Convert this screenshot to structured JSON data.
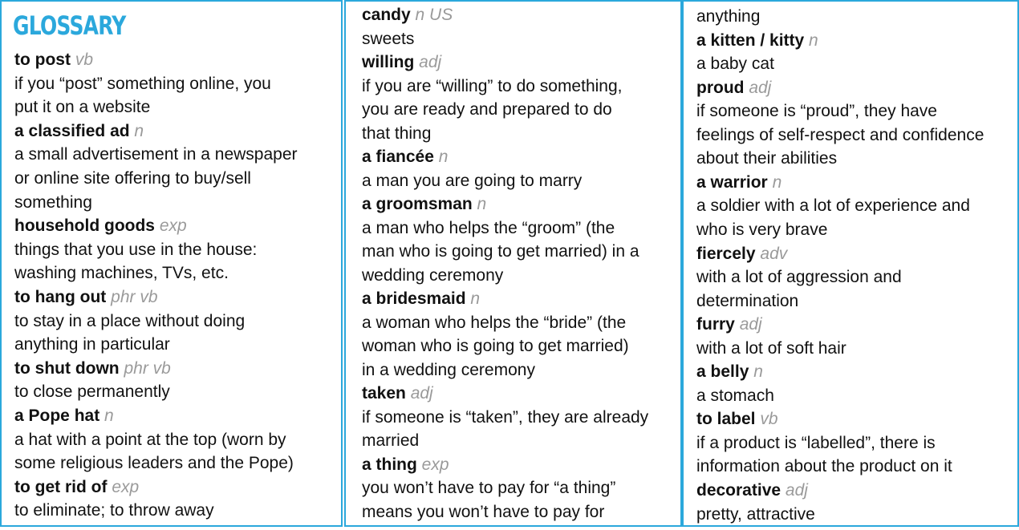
{
  "heading": "GLOSSARY",
  "columns": [
    {
      "lines": [
        {
          "type": "term",
          "term": "to post",
          "pos": "vb"
        },
        {
          "type": "text",
          "text": "if you “post” something online, you"
        },
        {
          "type": "text",
          "text": "put it on a website"
        },
        {
          "type": "term",
          "term": "a classified ad",
          "pos": "n"
        },
        {
          "type": "text",
          "text": "a small advertisement in a newspaper"
        },
        {
          "type": "text",
          "text": "or online site offering to buy/sell"
        },
        {
          "type": "text",
          "text": "something"
        },
        {
          "type": "term",
          "term": "household goods",
          "pos": "exp"
        },
        {
          "type": "text",
          "text": "things that you use in the house:"
        },
        {
          "type": "text",
          "text": "washing machines, TVs, etc."
        },
        {
          "type": "term",
          "term": "to hang out",
          "pos": "phr vb"
        },
        {
          "type": "text",
          "text": "to stay in a place without doing"
        },
        {
          "type": "text",
          "text": "anything in particular"
        },
        {
          "type": "term",
          "term": "to shut down",
          "pos": "phr vb"
        },
        {
          "type": "text",
          "text": "to close permanently"
        },
        {
          "type": "term",
          "term": "a Pope hat",
          "pos": "n"
        },
        {
          "type": "text",
          "text": "a hat with a point at the top (worn by"
        },
        {
          "type": "text",
          "text": "some religious leaders and the Pope)"
        },
        {
          "type": "term",
          "term": "to get rid of",
          "pos": "exp"
        },
        {
          "type": "text",
          "text": "to eliminate; to throw away"
        }
      ]
    },
    {
      "lines": [
        {
          "type": "term",
          "term": "candy",
          "pos": "n US"
        },
        {
          "type": "text",
          "text": "sweets"
        },
        {
          "type": "term",
          "term": "willing",
          "pos": "adj"
        },
        {
          "type": "text",
          "text": "if you are “willing” to do something,"
        },
        {
          "type": "text",
          "text": "you are ready and prepared to do"
        },
        {
          "type": "text",
          "text": "that thing"
        },
        {
          "type": "term",
          "term": "a fiancée",
          "pos": "n"
        },
        {
          "type": "text",
          "text": "a man you are going to marry"
        },
        {
          "type": "term",
          "term": "a groomsman",
          "pos": "n"
        },
        {
          "type": "text",
          "text": "a man who helps the “groom” (the"
        },
        {
          "type": "text",
          "text": "man who is going to get married) in a"
        },
        {
          "type": "text",
          "text": "wedding ceremony"
        },
        {
          "type": "term",
          "term": "a bridesmaid",
          "pos": "n"
        },
        {
          "type": "text",
          "text": "a woman who helps the “bride” (the"
        },
        {
          "type": "text",
          "text": "woman who is going to get married)"
        },
        {
          "type": "text",
          "text": "in a wedding ceremony"
        },
        {
          "type": "term",
          "term": "taken",
          "pos": "adj"
        },
        {
          "type": "text",
          "text": "if someone is “taken”, they are already"
        },
        {
          "type": "text",
          "text": "married"
        },
        {
          "type": "term",
          "term": "a thing",
          "pos": "exp"
        },
        {
          "type": "text",
          "text": "you won’t have to pay for “a thing”"
        },
        {
          "type": "text",
          "text": "means you won’t have to pay for"
        }
      ]
    },
    {
      "lines": [
        {
          "type": "text",
          "text": "anything"
        },
        {
          "type": "term",
          "term": "a kitten / kitty",
          "pos": "n"
        },
        {
          "type": "text",
          "text": "a baby cat"
        },
        {
          "type": "term",
          "term": "proud",
          "pos": "adj"
        },
        {
          "type": "text",
          "text": "if someone is “proud”, they have"
        },
        {
          "type": "text",
          "text": "feelings of self-respect and confidence"
        },
        {
          "type": "text",
          "text": "about their abilities"
        },
        {
          "type": "term",
          "term": "a warrior",
          "pos": "n"
        },
        {
          "type": "text",
          "text": "a soldier with a lot of experience and"
        },
        {
          "type": "text",
          "text": "who is very brave"
        },
        {
          "type": "term",
          "term": "fiercely",
          "pos": "adv"
        },
        {
          "type": "text",
          "text": "with a lot of aggression and"
        },
        {
          "type": "text",
          "text": "determination"
        },
        {
          "type": "term",
          "term": "furry",
          "pos": "adj"
        },
        {
          "type": "text",
          "text": "with a lot of soft hair"
        },
        {
          "type": "term",
          "term": "a belly",
          "pos": "n"
        },
        {
          "type": "text",
          "text": "a stomach"
        },
        {
          "type": "term",
          "term": "to label",
          "pos": "vb"
        },
        {
          "type": "text",
          "text": "if a product is “labelled”, there is"
        },
        {
          "type": "text",
          "text": "information about the product on it"
        },
        {
          "type": "term",
          "term": "decorative",
          "pos": "adj"
        },
        {
          "type": "text",
          "text": "pretty, attractive"
        }
      ]
    }
  ]
}
